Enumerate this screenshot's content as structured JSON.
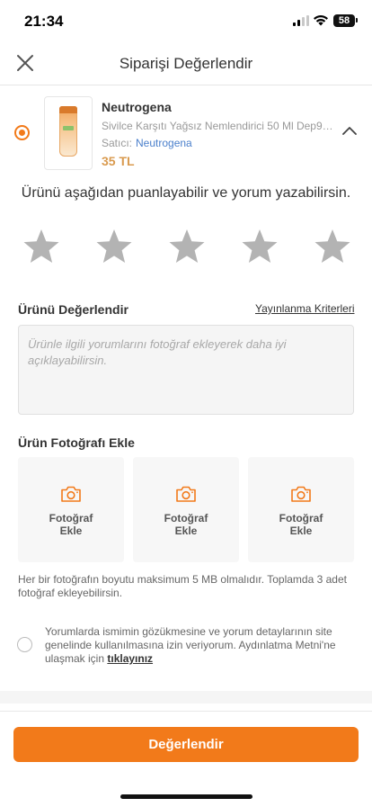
{
  "status_bar": {
    "time": "21:34",
    "battery": "58"
  },
  "header": {
    "title": "Siparişi Değerlendir"
  },
  "product": {
    "brand": "Neutrogena",
    "name": "Sivilce Karşıtı Yağsız Nemlendirici 50 Ml Dep99...",
    "seller_label": "Satıcı:",
    "seller_name": "Neutrogena",
    "price": "35 TL"
  },
  "rating": {
    "prompt": "Ürünü aşağıdan puanlayabilir ve yorum yazabilirsin.",
    "max_stars": 5,
    "selected_stars": 0
  },
  "review": {
    "title": "Ürünü Değerlendir",
    "criteria_link": "Yayınlanma Kriterleri",
    "placeholder": "Ürünle ilgili yorumlarını fotoğraf ekleyerek daha iyi açıklayabilirsin."
  },
  "photos": {
    "title": "Ürün Fotoğrafı Ekle",
    "slots": [
      {
        "line1": "Fotoğraf",
        "line2": "Ekle"
      },
      {
        "line1": "Fotoğraf",
        "line2": "Ekle"
      },
      {
        "line1": "Fotoğraf",
        "line2": "Ekle"
      }
    ],
    "note": "Her bir fotoğrafın boyutu maksimum 5 MB olmalıdır. Toplamda 3 adet fotoğraf ekleyebilirsin."
  },
  "consent": {
    "text": "Yorumlarda ismimin gözükmesine ve yorum detaylarının site genelinde kullanılmasına izin veriyorum. Aydınlatma Metni'ne ulaşmak için ",
    "link": "tıklayınız"
  },
  "submit": {
    "label": "Değerlendir"
  },
  "colors": {
    "accent": "#f27a1a",
    "star_empty": "#b3b3b3",
    "link": "#4a7fcb",
    "price": "#d99a4e"
  },
  "icons": {
    "close": "close-icon",
    "collapse": "chevron-up-icon",
    "star": "star-icon",
    "camera": "camera-icon"
  }
}
